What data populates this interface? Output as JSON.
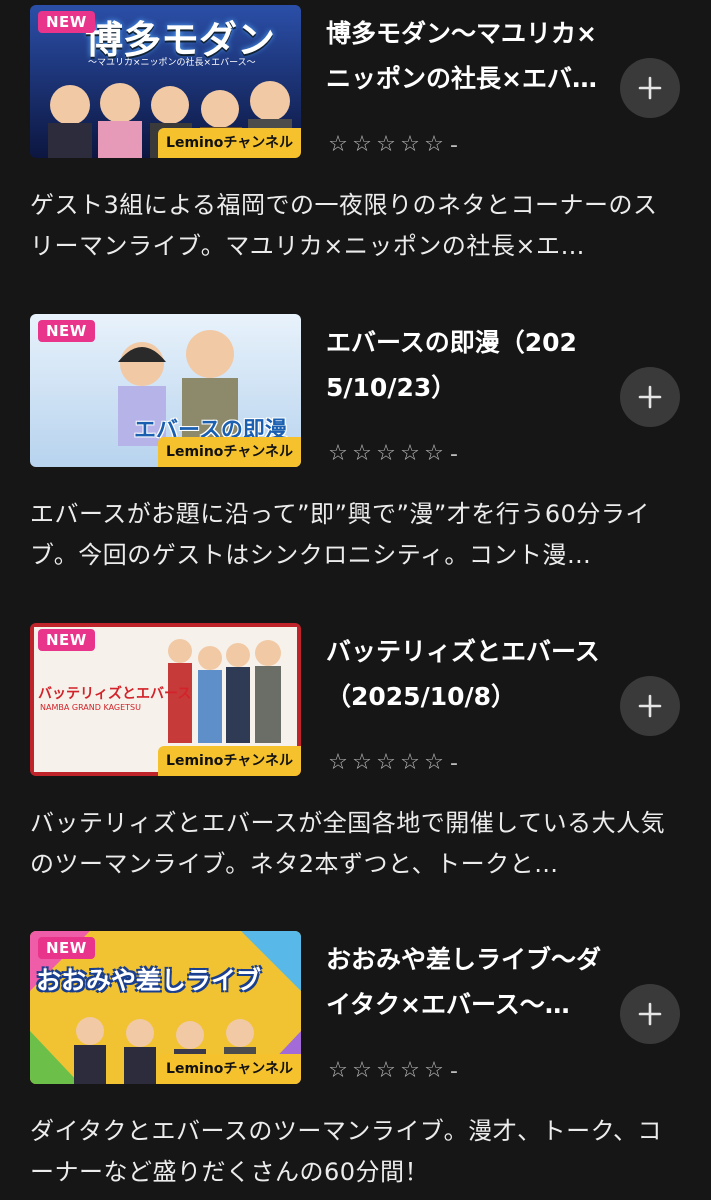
{
  "items": [
    {
      "title": "博多モダン〜マユリカ×ニッポンの社長×エバ…",
      "thumb_new": "NEW",
      "thumb_title": "博多モダン",
      "thumb_subtitle": "〜マユリカ×ニッポンの社長×エバース〜",
      "channel": "Leminoチャンネル",
      "rating": "-",
      "description": "ゲスト3組による福岡での一夜限りのネタとコーナーのスリーマンライブ。マユリカ×ニッポンの社長×エ…",
      "colors": {
        "bg": "#1d3a7a"
      }
    },
    {
      "title": "エバースの即漫（2025/10/23）",
      "thumb_new": "NEW",
      "thumb_title": "エバースの即漫",
      "channel": "Leminoチャンネル",
      "rating": "-",
      "description": "エバースがお題に沿って”即”興で”漫”才を行う60分ライブ。今回のゲストはシンクロニシティ。コント漫…",
      "colors": {
        "bg": "#dbe9f7"
      }
    },
    {
      "title": "バッテリィズとエバース（2025/10/8）",
      "thumb_new": "NEW",
      "thumb_title": "バッテリィズとエバース",
      "thumb_subtitle": "NAMBA GRAND KAGETSU",
      "channel": "Leminoチャンネル",
      "rating": "-",
      "description": "バッテリィズとエバースが全国各地で開催している大人気のツーマンライブ。ネタ2本ずつと、トークと…",
      "colors": {
        "bg": "#f6f1ea"
      }
    },
    {
      "title": "おおみや差しライブ〜ダイタク×エバース〜…",
      "thumb_new": "NEW",
      "thumb_title": "おおみや差しライブ",
      "channel": "Leminoチャンネル",
      "rating": "-",
      "description": "ダイタクとエバースのツーマンライブ。漫才、トーク、コーナーなど盛りだくさんの60分間！",
      "colors": {
        "bg": "#f1c232"
      }
    }
  ]
}
